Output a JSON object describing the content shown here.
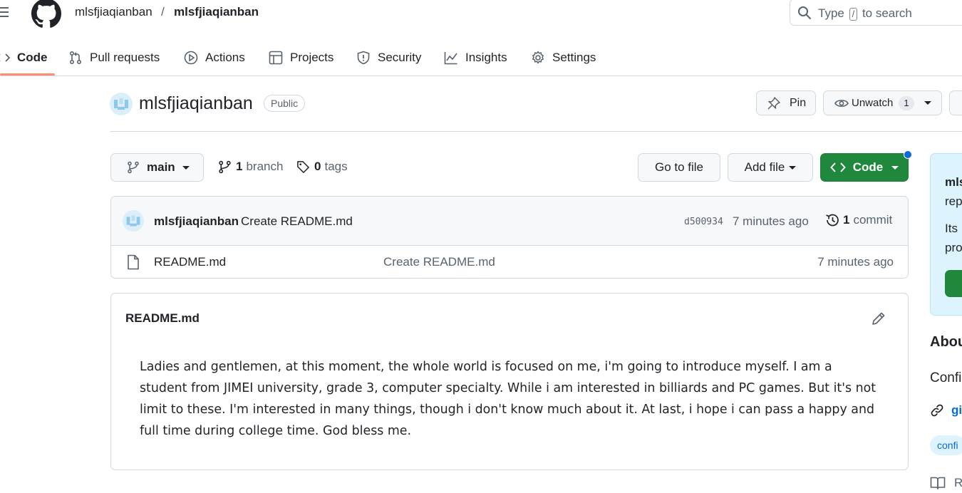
{
  "header": {
    "owner": "mlsfjiaqianban",
    "separator": "/",
    "repo": "mlsfjiaqianban",
    "search": {
      "prefix": "Type",
      "key": "/",
      "suffix": "to search"
    }
  },
  "nav": {
    "tabs": [
      {
        "label": "Code",
        "active": true,
        "icon": "code-icon"
      },
      {
        "label": "Pull requests",
        "icon": "pull-request-icon"
      },
      {
        "label": "Actions",
        "icon": "play-icon"
      },
      {
        "label": "Projects",
        "icon": "table-icon"
      },
      {
        "label": "Security",
        "icon": "shield-icon"
      },
      {
        "label": "Insights",
        "icon": "graph-icon"
      },
      {
        "label": "Settings",
        "icon": "gear-icon"
      }
    ]
  },
  "repo": {
    "name": "mlsfjiaqianban",
    "visibility": "Public",
    "pin_label": "Pin",
    "watch_label": "Unwatch",
    "watch_count": "1"
  },
  "toolbar": {
    "branch": "main",
    "branch_count": "1",
    "branch_word": "branch",
    "tag_count": "0",
    "tag_word": "tags",
    "goto_file": "Go to file",
    "add_file": "Add file",
    "code": "Code"
  },
  "latest_commit": {
    "author": "mlsfjiaqianban",
    "message": "Create README.md",
    "sha": "d500934",
    "time": "7 minutes ago",
    "commit_count": "1",
    "commit_word": "commit"
  },
  "files": [
    {
      "name": "README.md",
      "commit_message": "Create README.md",
      "time": "7 minutes ago"
    }
  ],
  "readme": {
    "title": "README.md",
    "body": "Ladies and gentlemen, at this moment, the whole world is focused on me, i'm going to introduce myself. I am a student from JIMEI university, grade 3, computer specialty. While i am interested in billiards and PC games. But it's not limit to these. I'm interested in many things, though i don't know much about it. At last, i hope i can pass a happy and full time during college time. God bless me."
  },
  "sidebar": {
    "promo": {
      "heading": "mls",
      "line1": "rep",
      "line2": "Its",
      "line3": "pro"
    },
    "about_heading": "Abou",
    "description": "Confi",
    "link": "gi",
    "topic": "confi",
    "readme_label": "R"
  },
  "colors": {
    "accent_green": "#1f883d",
    "link_blue": "#0969da",
    "tab_underline": "#fd8c73",
    "border": "#d1d9e0"
  }
}
